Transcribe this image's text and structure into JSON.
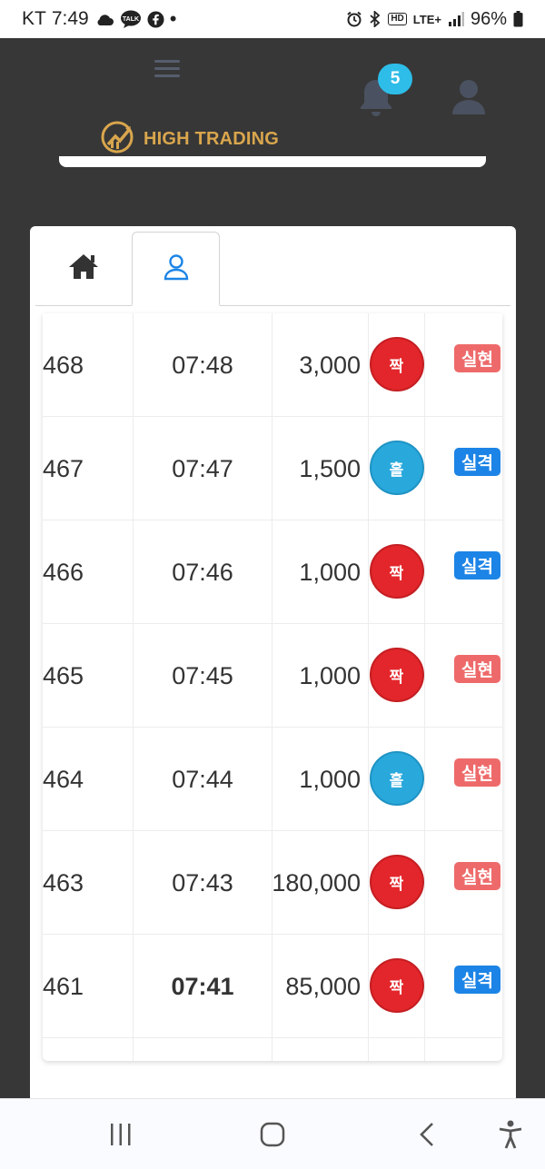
{
  "status_bar": {
    "carrier": "KT",
    "time": "7:49",
    "talk_label": "TALK",
    "hd_label": "HD",
    "network": "LTE+",
    "battery": "96%"
  },
  "header": {
    "notification_count": "5",
    "logo_text": "HIGH TRADING"
  },
  "colors": {
    "accent_gold": "#d9a64d",
    "badge_blue": "#2dbde8",
    "ball_red": "#e3262b",
    "ball_blue": "#29a8dc",
    "tag_hit": "#ee6a6a",
    "tag_miss": "#1c84e6"
  },
  "tabs": [
    {
      "icon": "home-icon",
      "active": false
    },
    {
      "icon": "user-icon",
      "active": true
    }
  ],
  "rows": [
    {
      "id": "468",
      "time": "07:48",
      "amount": "3,000",
      "pick": "짝",
      "pick_color": "red",
      "result": "실현",
      "result_type": "hit",
      "bold": false
    },
    {
      "id": "467",
      "time": "07:47",
      "amount": "1,500",
      "pick": "홀",
      "pick_color": "blue",
      "result": "실격",
      "result_type": "miss",
      "bold": false
    },
    {
      "id": "466",
      "time": "07:46",
      "amount": "1,000",
      "pick": "짝",
      "pick_color": "red",
      "result": "실격",
      "result_type": "miss",
      "bold": false
    },
    {
      "id": "465",
      "time": "07:45",
      "amount": "1,000",
      "pick": "짝",
      "pick_color": "red",
      "result": "실현",
      "result_type": "hit",
      "bold": false
    },
    {
      "id": "464",
      "time": "07:44",
      "amount": "1,000",
      "pick": "홀",
      "pick_color": "blue",
      "result": "실현",
      "result_type": "hit",
      "bold": false
    },
    {
      "id": "463",
      "time": "07:43",
      "amount": "180,000",
      "pick": "짝",
      "pick_color": "red",
      "result": "실현",
      "result_type": "hit",
      "bold": false
    },
    {
      "id": "461",
      "time": "07:41",
      "amount": "85,000",
      "pick": "짝",
      "pick_color": "red",
      "result": "실격",
      "result_type": "miss",
      "bold": true
    }
  ]
}
